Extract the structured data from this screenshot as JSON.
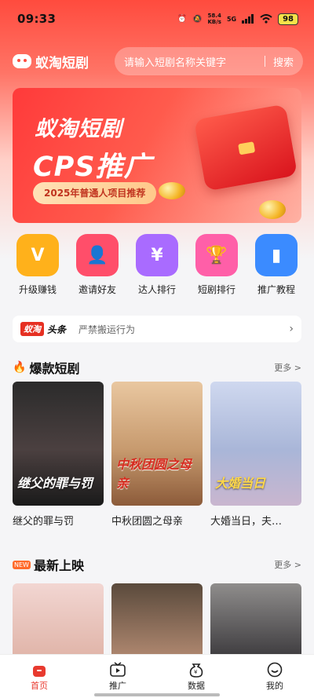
{
  "status_bar": {
    "time": "09:33",
    "speed_value": "58.4",
    "speed_unit": "KB/s",
    "network": "5G",
    "battery": "98"
  },
  "header": {
    "logo_text": "蚁淘短剧",
    "search_placeholder": "请输入短剧名称关键字",
    "search_button": "搜索"
  },
  "banner": {
    "title": "蚁淘短剧",
    "subtitle": "CPS推广",
    "pill": "2025年普通人项目推荐"
  },
  "quick_actions": [
    {
      "label": "升级赚钱",
      "icon": "upgrade-icon",
      "color": "#ffb11b"
    },
    {
      "label": "邀请好友",
      "icon": "invite-user-icon",
      "color": "#ff4e6a"
    },
    {
      "label": "达人排行",
      "icon": "money-bag-icon",
      "color": "#a96bff"
    },
    {
      "label": "短剧排行",
      "icon": "trophy-icon",
      "color": "#ff5fa8"
    },
    {
      "label": "推广教程",
      "icon": "book-icon",
      "color": "#3b8bff"
    }
  ],
  "notice": {
    "tag": "蚁淘",
    "head": "头条",
    "text": "严禁搬运行为"
  },
  "hot_section": {
    "title": "爆款短剧",
    "more": "更多 >"
  },
  "hot_dramas": [
    {
      "name": "继父的罪与罚",
      "poster_text": "继父的罪与罚"
    },
    {
      "name": "中秋团圆之母亲",
      "poster_text": "中秋团圆之母亲"
    },
    {
      "name": "大婚当日，夫…",
      "poster_text": "大婚当日"
    }
  ],
  "new_section": {
    "title": "最新上映",
    "more": "更多 >"
  },
  "tabbar": [
    {
      "label": "首页",
      "active": true
    },
    {
      "label": "推广",
      "active": false
    },
    {
      "label": "数据",
      "active": false
    },
    {
      "label": "我的",
      "active": false
    }
  ]
}
